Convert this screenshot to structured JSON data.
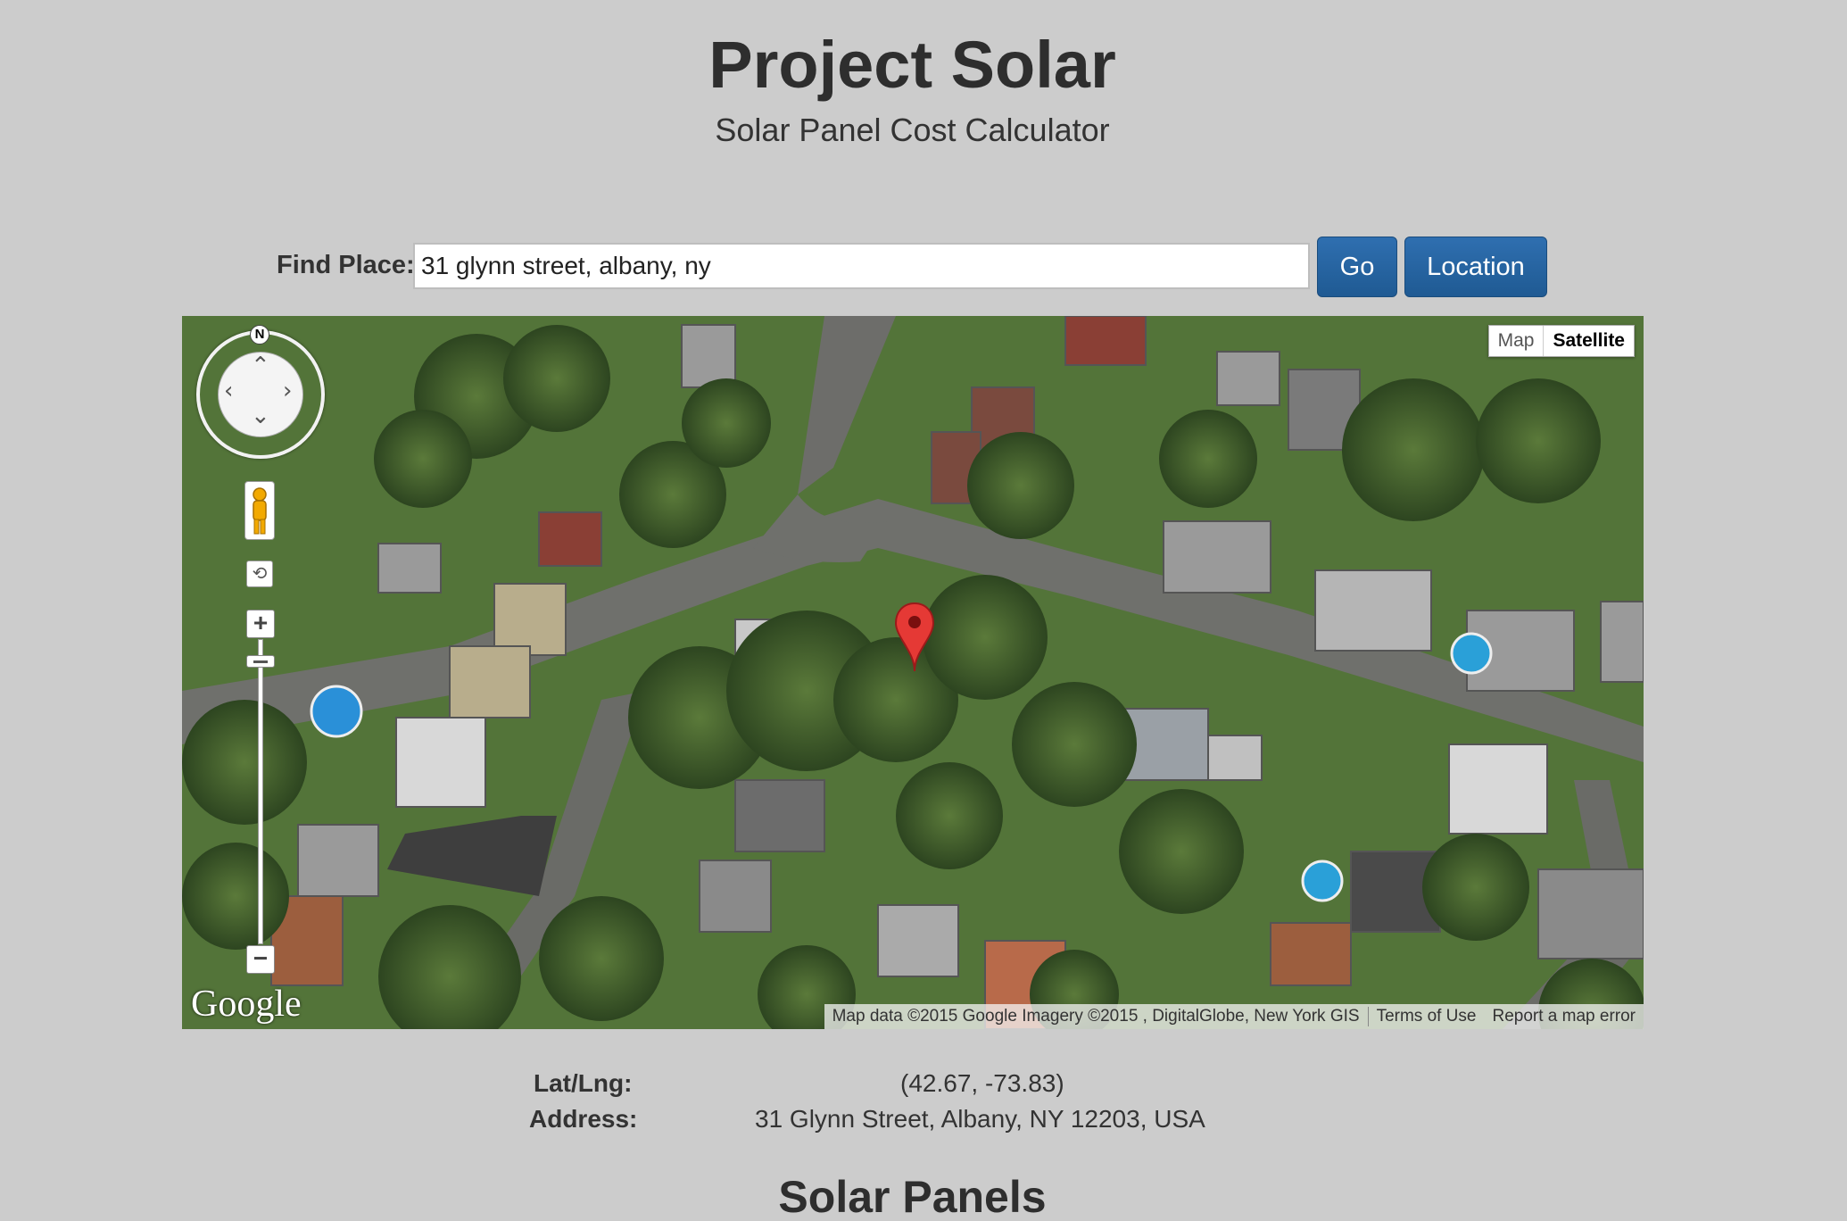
{
  "header": {
    "title": "Project Solar",
    "subtitle": "Solar Panel Cost Calculator"
  },
  "search": {
    "label": "Find Place:",
    "value": "31 glynn street, albany, ny",
    "go_label": "Go",
    "location_label": "Location"
  },
  "map": {
    "type_map_label": "Map",
    "type_satellite_label": "Satellite",
    "selected_type": "Satellite",
    "compass_label": "N",
    "logo_text": "Google",
    "attribution": "Map data ©2015 Google Imagery ©2015 , DigitalGlobe, New York GIS",
    "terms_label": "Terms of Use",
    "report_label": "Report a map error",
    "icons": [
      "pan-control-icon",
      "pegman-icon",
      "rotate-icon",
      "zoom-in-icon",
      "zoom-out-icon",
      "map-marker-icon"
    ],
    "marker_color": "#e53935"
  },
  "info": {
    "latlng_label": "Lat/Lng:",
    "latlng_value": "(42.67, -73.83)",
    "address_label": "Address:",
    "address_value": "31 Glynn Street, Albany, NY 12203, USA"
  },
  "sections": {
    "solar_panels_title": "Solar Panels"
  },
  "colors": {
    "background": "#cccccc",
    "button": "#1f5a93"
  }
}
